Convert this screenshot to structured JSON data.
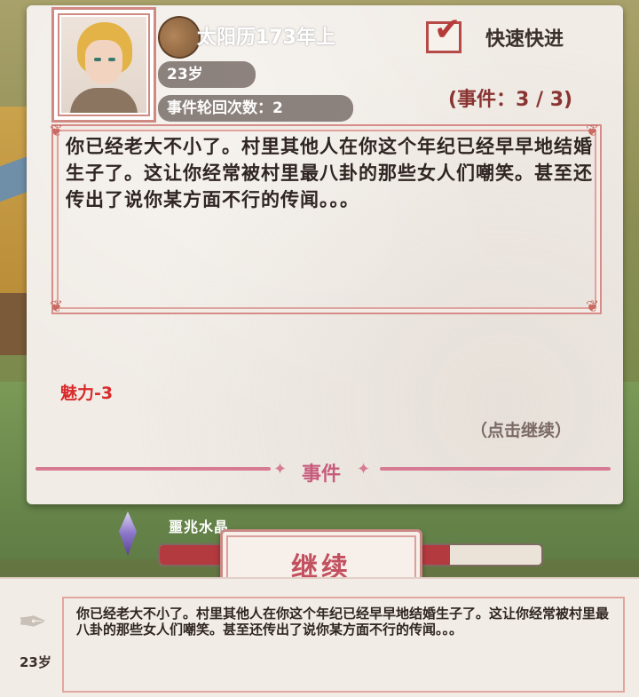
{
  "header": {
    "calendar": "太阳历173年上",
    "age": "23岁",
    "cycle_count": "事件轮回次数：2",
    "fast_forward_label": "快速快进",
    "event_counter": "(事件：3 / 3)"
  },
  "event": {
    "text": "你已经老大不小了。村里其他人在你这个年纪已经早早地结婚生子了。这让你经常被村里最八卦的那些女人们嘲笑。甚至还传出了说你某方面不行的传闻。。。",
    "effect": "魅力-3",
    "tap_hint": "（点击继续）",
    "section_label": "事件"
  },
  "crystal": {
    "label": "噩兆水晶",
    "progress": 0.76
  },
  "continue_button": "继续",
  "log": {
    "age": "23岁",
    "text": "你已经老大不小了。村里其他人在你这个年纪已经早早地结婚生子了。这让你经常被村里最八卦的那些女人们嘲笑。甚至还传出了说你某方面不行的传闻。。。"
  },
  "colors": {
    "accent": "#d67b93",
    "effect": "#d92a2a",
    "progress_fill": "#b33a3f"
  }
}
